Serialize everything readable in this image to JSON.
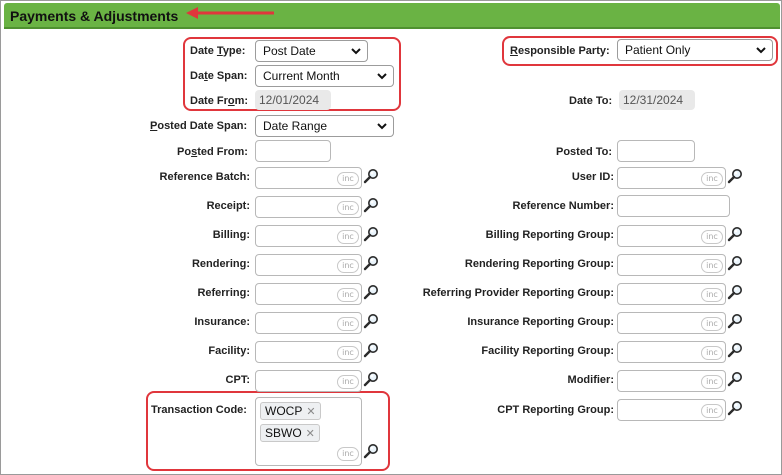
{
  "header": {
    "title": "Payments & Adjustments"
  },
  "inc_label": "inc",
  "date_type": {
    "label": "Date Type:",
    "value": "Post Date"
  },
  "date_span": {
    "label": "Date Span:",
    "value": "Current Month"
  },
  "date_from": {
    "label": "Date From:",
    "value": "12/01/2024"
  },
  "date_to": {
    "label": "Date To:",
    "value": "12/31/2024"
  },
  "responsible_party": {
    "label": "Responsible Party:",
    "value": "Patient Only"
  },
  "posted_date_span": {
    "label": "Posted Date Span:",
    "value": "Date Range"
  },
  "posted_from": {
    "label": "Posted From:"
  },
  "posted_to": {
    "label": "Posted To:"
  },
  "left_fields": [
    {
      "label": "Reference Batch:"
    },
    {
      "label": "Receipt:"
    },
    {
      "label": "Billing:"
    },
    {
      "label": "Rendering:"
    },
    {
      "label": "Referring:"
    },
    {
      "label": "Insurance:"
    },
    {
      "label": "Facility:"
    },
    {
      "label": "CPT:"
    }
  ],
  "right_fields": [
    {
      "label": "User ID:"
    },
    {
      "label": "Reference Number:"
    },
    {
      "label": "Billing Reporting Group:"
    },
    {
      "label": "Rendering Reporting Group:"
    },
    {
      "label": "Referring Provider Reporting Group:"
    },
    {
      "label": "Insurance Reporting Group:"
    },
    {
      "label": "Facility Reporting Group:"
    },
    {
      "label": "Modifier:"
    },
    {
      "label": "CPT Reporting Group:"
    }
  ],
  "transaction_code": {
    "label": "Transaction Code:",
    "tags": [
      "WOCP",
      "SBWO"
    ]
  },
  "colors": {
    "header": "#6ab344",
    "highlight": "#e0363c"
  },
  "icons": {
    "lookup": "magnifier-icon",
    "remove": "close-icon",
    "dropdown": "chevron-down-icon"
  }
}
